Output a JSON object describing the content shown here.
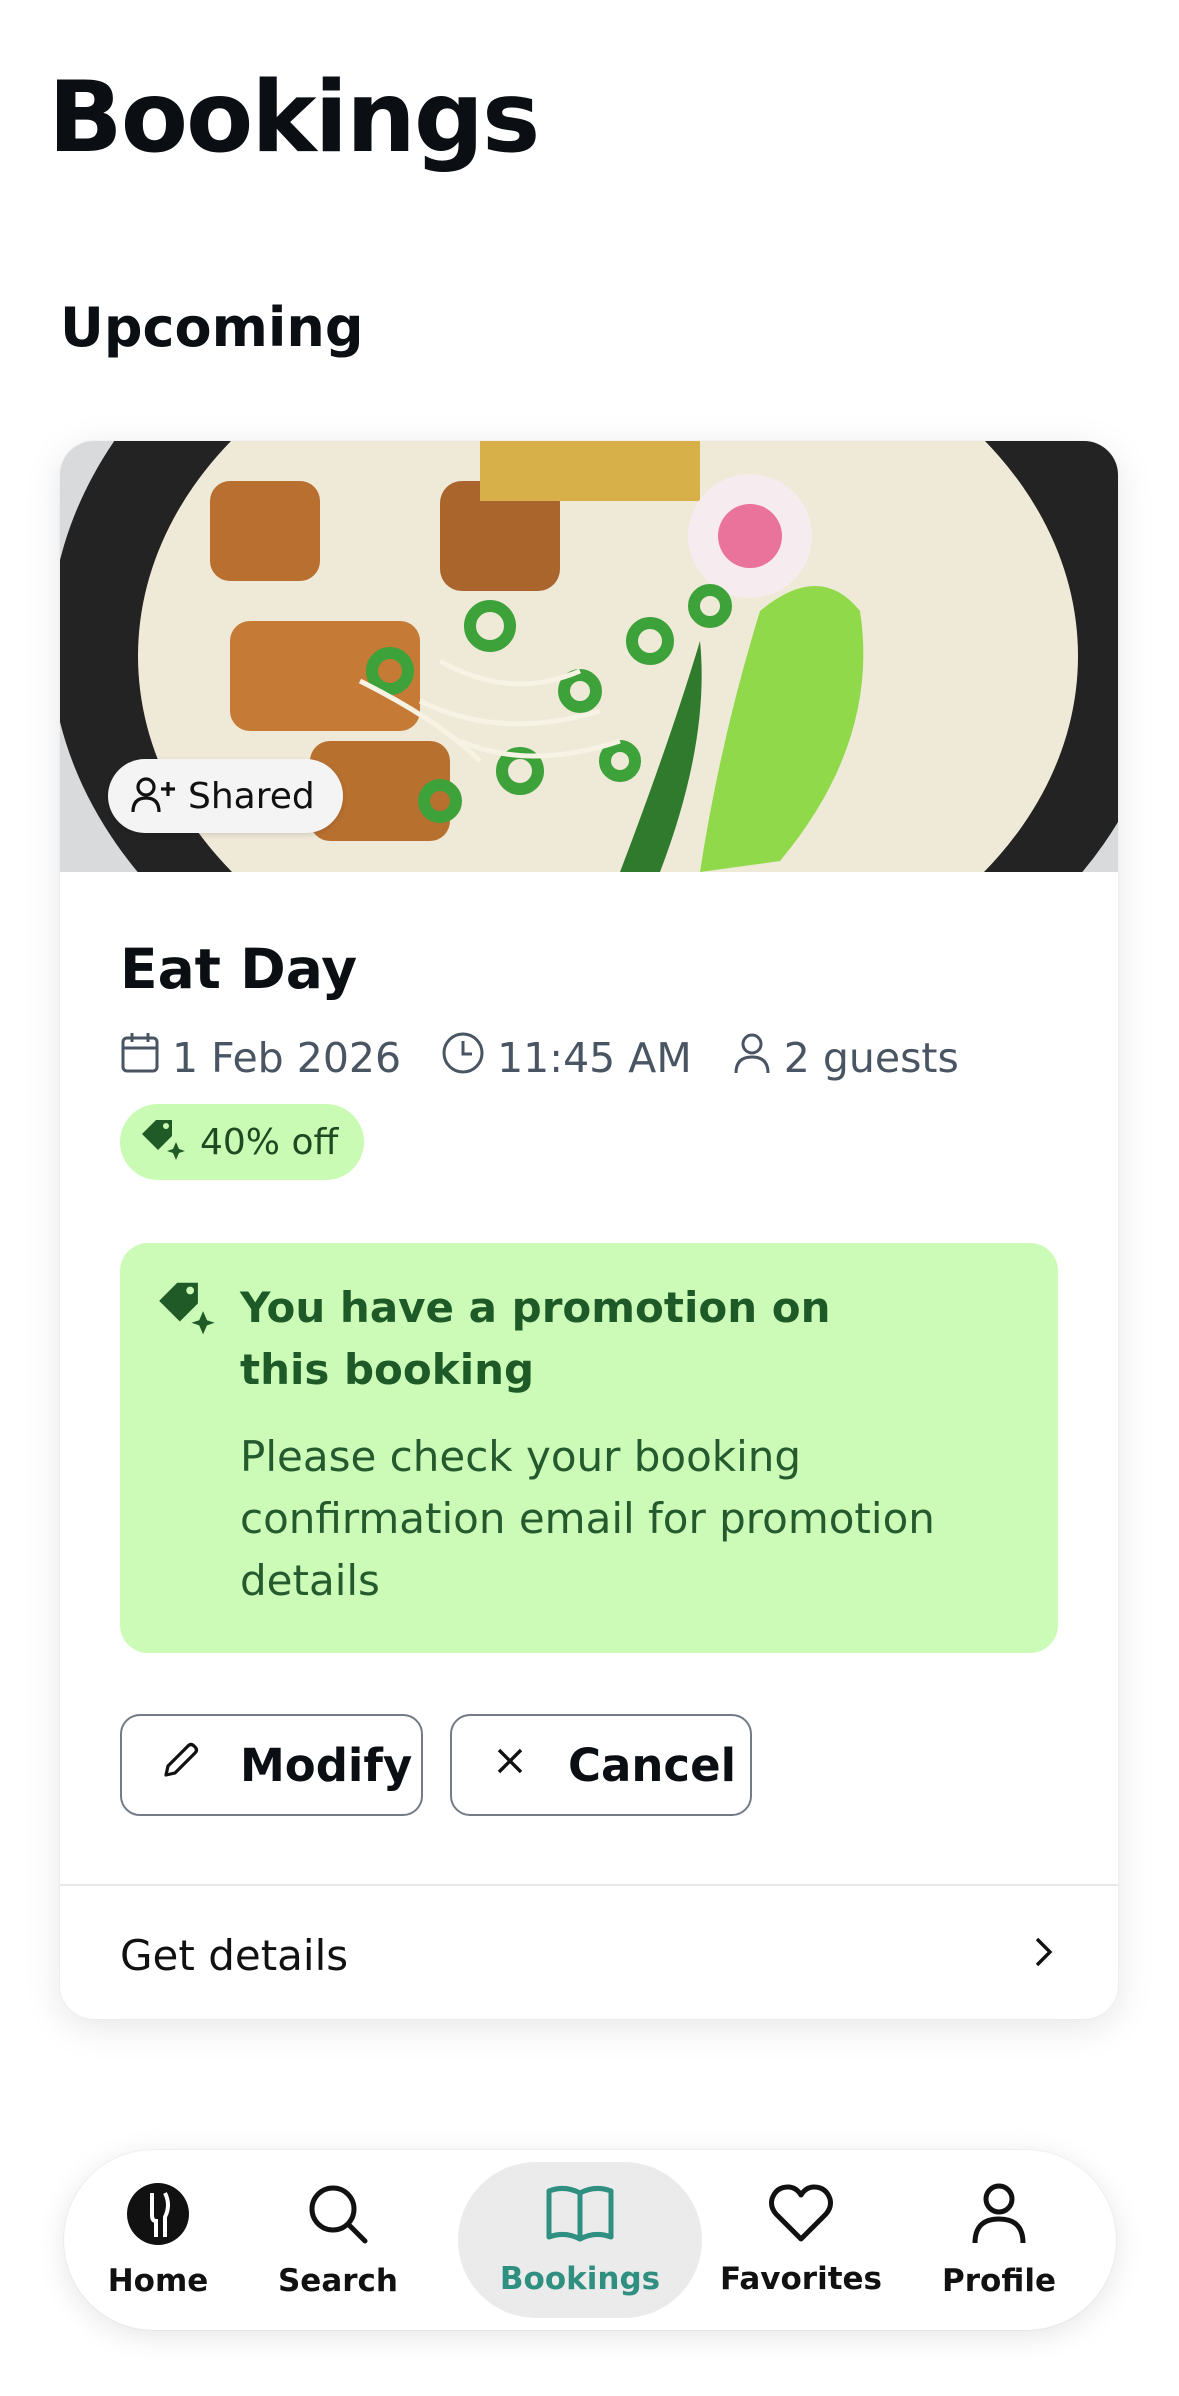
{
  "page": {
    "title": "Bookings",
    "section": "Upcoming"
  },
  "booking": {
    "shared_label": "Shared",
    "restaurant": "Eat Day",
    "date": "1 Feb 2026",
    "time": "11:45 AM",
    "guests": "2 guests",
    "discount": "40% off",
    "promotion": {
      "title": "You have a promotion on this booking",
      "body": "Please check your booking confirmation email for promotion details"
    },
    "actions": {
      "modify": "Modify",
      "cancel": "Cancel"
    },
    "details_link": "Get details"
  },
  "nav": {
    "items": [
      {
        "label": "Home",
        "icon": "home-icon"
      },
      {
        "label": "Search",
        "icon": "search-icon"
      },
      {
        "label": "Bookings",
        "icon": "book-icon",
        "active": true
      },
      {
        "label": "Favorites",
        "icon": "heart-icon"
      },
      {
        "label": "Profile",
        "icon": "person-icon"
      }
    ]
  },
  "colors": {
    "promo_bg": "#ccfbb8",
    "promo_text": "#1e5a28",
    "active_nav": "#2f8f80",
    "meta_text": "#4a5563"
  }
}
